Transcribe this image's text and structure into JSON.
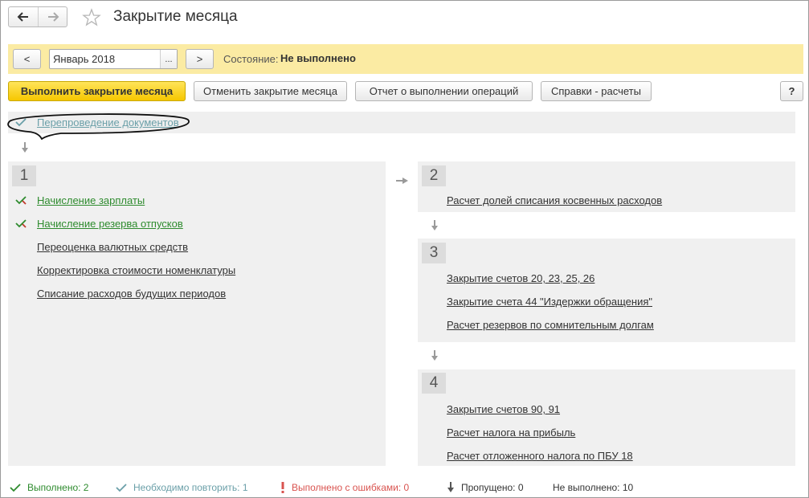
{
  "window": {
    "title": "Закрытие месяца"
  },
  "period": {
    "prev_label": "<",
    "next_label": ">",
    "value": "Январь 2018",
    "picker_label": "...",
    "state_label": "Состояние:",
    "state_value": "Не выполнено"
  },
  "toolbar": {
    "run_label": "Выполнить закрытие месяца",
    "cancel_label": "Отменить закрытие месяца",
    "report_label": "Отчет о выполнении операций",
    "calcs_label": "Справки - расчеты",
    "help_label": "?"
  },
  "repost": {
    "label": "Перепроведение документов"
  },
  "stages": {
    "s1": {
      "number": "1",
      "items": [
        "Начисление зарплаты",
        "Начисление резерва отпусков",
        "Переоценка валютных средств",
        "Корректировка стоимости номенклатуры",
        "Списание расходов будущих периодов"
      ]
    },
    "s2": {
      "number": "2",
      "items": [
        "Расчет долей списания косвенных расходов"
      ]
    },
    "s3": {
      "number": "3",
      "items": [
        "Закрытие счетов 20, 23, 25, 26",
        "Закрытие счета 44 \"Издержки обращения\"",
        "Расчет резервов по сомнительным долгам"
      ]
    },
    "s4": {
      "number": "4",
      "items": [
        "Закрытие счетов 90, 91",
        "Расчет налога на прибыль",
        "Расчет отложенного налога по ПБУ 18"
      ]
    }
  },
  "footer": {
    "done": "Выполнено: 2",
    "repeat": "Необходимо повторить: 1",
    "errors": "Выполнено с ошибками: 0",
    "skipped": "Пропущено:  0",
    "not_done": "Не выполнено:  10"
  },
  "colors": {
    "accent_yellow": "#f6c700",
    "period_bar": "#fbeba3",
    "done_green": "#2e8b2e",
    "repeat_teal": "#6a9fa8",
    "error_red": "#d9534f"
  }
}
